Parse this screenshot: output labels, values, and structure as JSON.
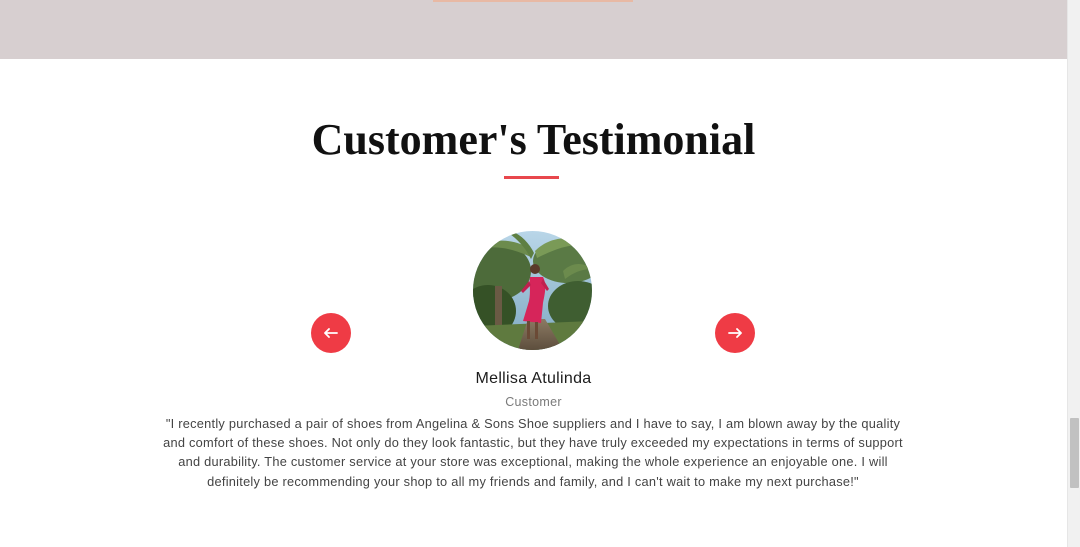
{
  "section": {
    "title": "Customer's Testimonial"
  },
  "testimonial": {
    "name": "Mellisa Atulinda",
    "role": "Customer",
    "quote": "\"I recently purchased a pair of shoes from Angelina & Sons Shoe suppliers and I have to say, I am blown away by the quality and comfort of these shoes. Not only do they look fantastic, but they have truly exceeded my expectations in terms of support and durability. The customer service at your store was exceptional, making the whole experience an enjoyable one. I will definitely be recommending your shop to all my friends and family, and I can't wait to make my next purchase!\""
  },
  "carousel": {
    "prev_icon": "arrow-left-icon",
    "next_icon": "arrow-right-icon"
  },
  "colors": {
    "accent": "#ef3b45",
    "top_band": "#d7cfd0",
    "title": "#111111"
  }
}
